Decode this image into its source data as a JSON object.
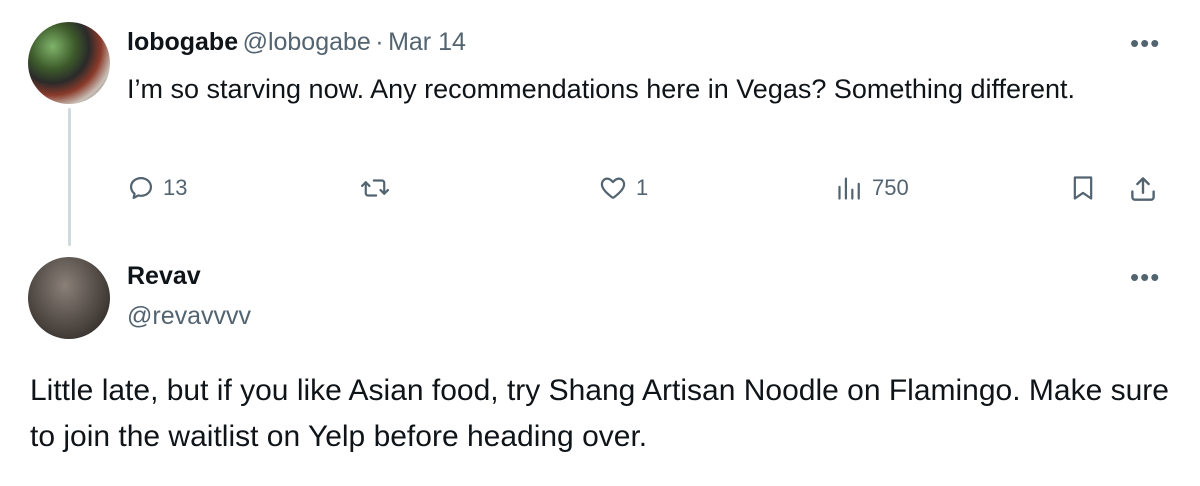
{
  "tweet": {
    "author_name": "lobogabe",
    "handle": "@lobogabe",
    "separator": "·",
    "date": "Mar 14",
    "text": "I’m so starving now. Any recommendations here in Vegas? Something different.",
    "more_icon": "more-horizontal-icon",
    "actions": {
      "replies": "13",
      "retweets": "",
      "likes": "1",
      "views": "750"
    }
  },
  "reply": {
    "author_name": "Revav",
    "handle": "@revavvvv",
    "text": "Little late, but if you like Asian food, try Shang Artisan Noodle on Flamingo. Make sure to join the waitlist on Yelp before heading over.",
    "more_icon": "more-horizontal-icon"
  },
  "colors": {
    "text": "#0f1419",
    "muted": "#536471",
    "thread_line": "#cfd9de"
  }
}
